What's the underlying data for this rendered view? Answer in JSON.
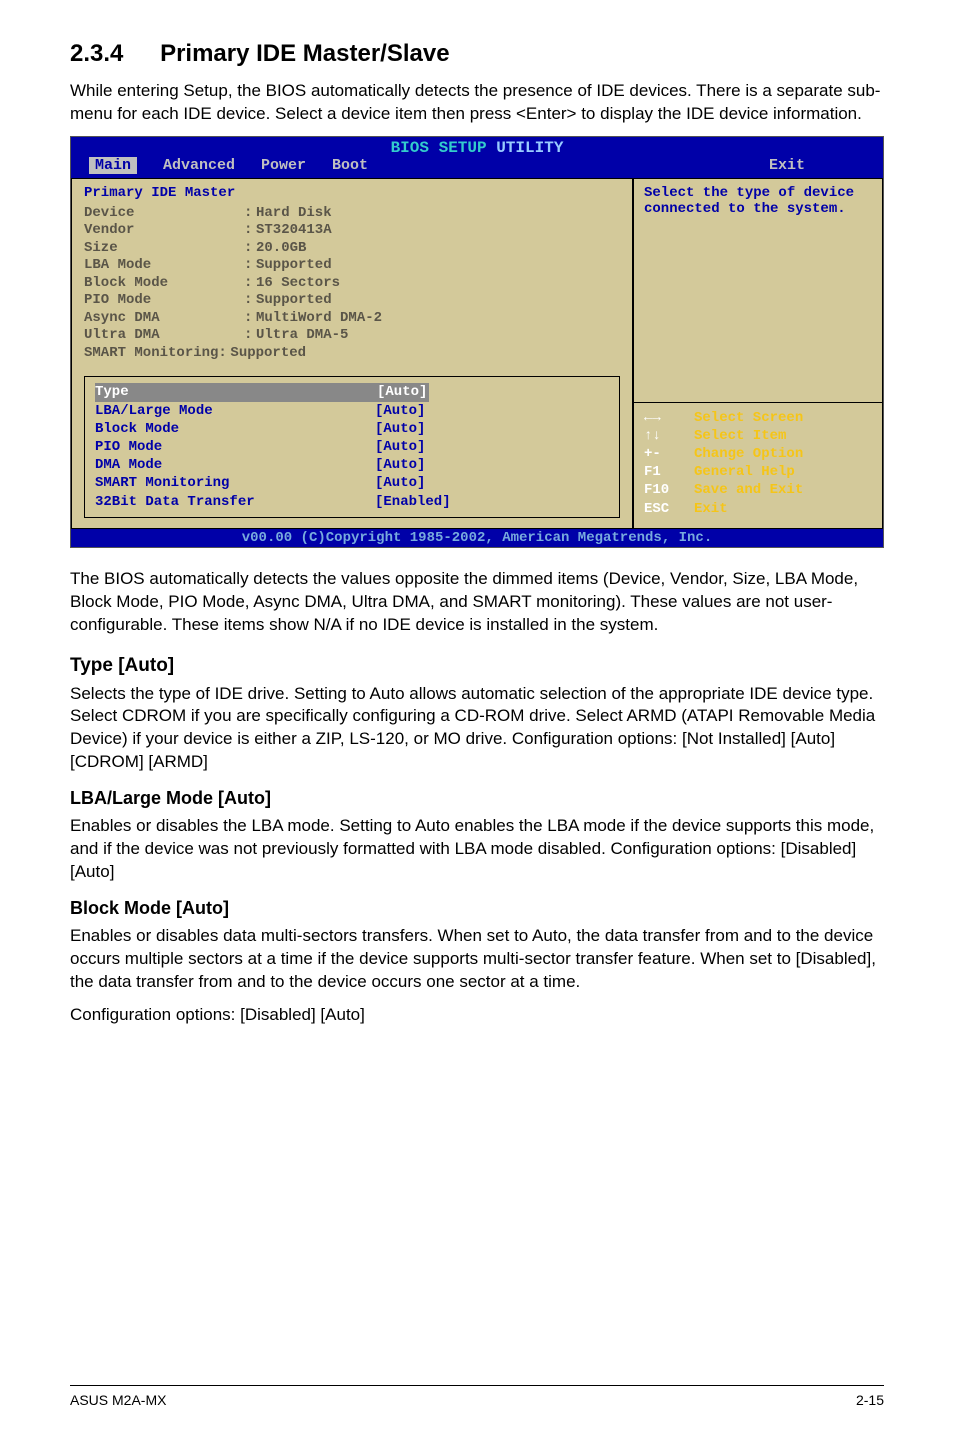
{
  "section": {
    "num": "2.3.4",
    "title": "Primary IDE Master/Slave"
  },
  "intro": "While entering Setup, the BIOS automatically detects the presence of IDE devices. There is a separate sub-menu for each IDE device. Select a device item then press <Enter> to display the IDE device information.",
  "bios": {
    "title_left": "BIOS SETUP",
    "title_right": "UTILITY",
    "tabs": {
      "active": "Main",
      "t1": "Advanced",
      "t2": "Power",
      "t3": "Boot",
      "last": "Exit"
    },
    "header_line": "Primary IDE Master",
    "detected": [
      {
        "k": "Device",
        "v": "Hard Disk"
      },
      {
        "k": "Vendor",
        "v": "ST320413A"
      },
      {
        "k": "Size",
        "v": "20.0GB"
      },
      {
        "k": "LBA Mode",
        "v": "Supported"
      },
      {
        "k": "Block Mode",
        "v": "16 Sectors"
      },
      {
        "k": "PIO Mode",
        "v": "Supported"
      },
      {
        "k": "Async DMA",
        "v": "MultiWord DMA-2"
      },
      {
        "k": "Ultra DMA",
        "v": "Ultra DMA-5"
      },
      {
        "k": "SMART Monitoring",
        "v": "Supported",
        "nosep": true
      }
    ],
    "settings": [
      {
        "k": "Type",
        "v": "[Auto]",
        "sel": true
      },
      {
        "k": "LBA/Large Mode",
        "v": "[Auto]"
      },
      {
        "k": "Block Mode",
        "v": "[Auto]"
      },
      {
        "k": "PIO Mode",
        "v": "[Auto]"
      },
      {
        "k": "DMA Mode",
        "v": "[Auto]"
      },
      {
        "k": "SMART Monitoring",
        "v": "[Auto]"
      },
      {
        "k": "32Bit Data Transfer",
        "v": "[Enabled]"
      }
    ],
    "right_help": "Select the type of device connected to the system.",
    "nav": [
      {
        "k": "←→",
        "l": "Select Screen"
      },
      {
        "k": "↑↓",
        "l": "Select Item"
      },
      {
        "k": "+-",
        "l": "Change Option"
      },
      {
        "k": "F1",
        "l": "General Help"
      },
      {
        "k": "F10",
        "l": "Save and Exit"
      },
      {
        "k": "ESC",
        "l": "Exit"
      }
    ],
    "footer": "v00.00 (C)Copyright 1985-2002, American Megatrends, Inc."
  },
  "after_bios": "The BIOS automatically detects the values opposite the dimmed items (Device, Vendor, Size, LBA Mode, Block Mode, PIO Mode, Async DMA, Ultra DMA, and SMART monitoring). These values are not user-configurable. These items show N/A if no IDE device is installed in the system.",
  "type_h": "Type [Auto]",
  "type_body": "Selects the type of IDE drive. Setting to Auto allows automatic selection of the appropriate IDE device type. Select CDROM if you are specifically configuring a CD-ROM drive. Select ARMD (ATAPI Removable Media Device) if your device is either a ZIP, LS-120, or MO drive. Configuration options: [Not Installed] [Auto] [CDROM] [ARMD]",
  "lba_h": "LBA/Large Mode [Auto]",
  "lba_body": "Enables or disables the LBA mode. Setting to Auto enables the LBA mode if the device supports this mode, and if the device was not previously formatted with LBA mode disabled. Configuration options: [Disabled] [Auto]",
  "block_h": "Block Mode [Auto]",
  "block_body1": "Enables or disables data multi-sectors transfers. When set to Auto, the data transfer from and to the device occurs multiple sectors at a time if the device supports multi-sector transfer feature. When set to [Disabled], the data transfer from and to the device occurs one sector at a time.",
  "block_body2": "Configuration options: [Disabled] [Auto]",
  "footer": {
    "left": "ASUS M2A-MX",
    "right": "2-15"
  }
}
